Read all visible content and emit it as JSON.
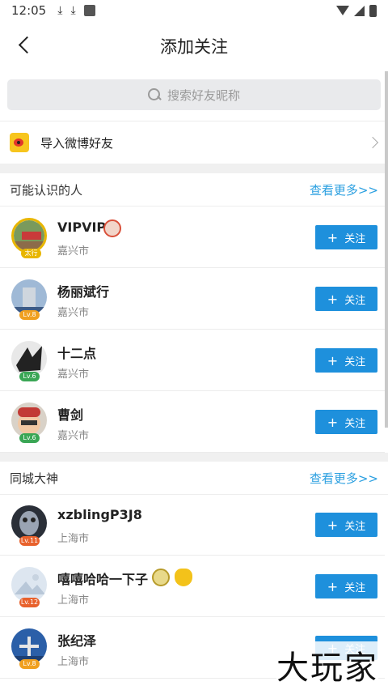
{
  "status": {
    "time": "12:05"
  },
  "header": {
    "title": "添加关注"
  },
  "search": {
    "placeholder": "搜索好友昵称"
  },
  "weibo": {
    "label": "导入微博好友"
  },
  "sections": [
    {
      "title": "可能认识的人",
      "more": "查看更多>>",
      "users": [
        {
          "name": "VIPVIP",
          "city": "嘉兴市",
          "level": "太行",
          "follow": "关注"
        },
        {
          "name": "杨丽斌行",
          "city": "嘉兴市",
          "level": "Lv.8",
          "follow": "关注"
        },
        {
          "name": "十二点",
          "city": "嘉兴市",
          "level": "Lv.6",
          "follow": "关注"
        },
        {
          "name": "曹剑",
          "city": "嘉兴市",
          "level": "Lv.6",
          "follow": "关注"
        }
      ]
    },
    {
      "title": "同城大神",
      "more": "查看更多>>",
      "users": [
        {
          "name": "xzblingP3J8",
          "city": "上海市",
          "level": "Lv.11",
          "follow": "关注"
        },
        {
          "name": "嘻嘻哈哈一下子",
          "city": "上海市",
          "level": "Lv.12",
          "follow": "关注"
        },
        {
          "name": "张纪泽",
          "city": "上海市",
          "level": "Lv.8",
          "follow": "关注"
        }
      ]
    }
  ],
  "watermark": "大玩家",
  "colors": {
    "accent": "#1e90dc",
    "link": "#2a9fe0"
  }
}
